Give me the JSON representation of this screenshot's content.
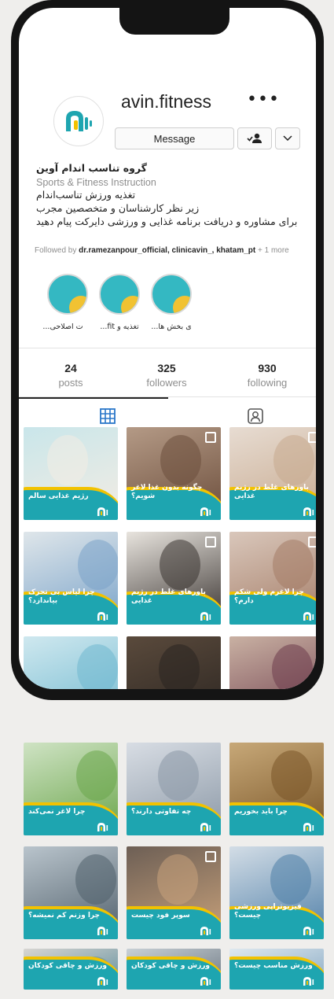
{
  "profile": {
    "username": "avin.fitness",
    "more_label": "•••",
    "message_label": "Message",
    "name": "گروه تناسب اندام آوین",
    "category": "Sports & Fitness Instruction",
    "bio_lines": [
      "تغذیه ورزش تناسب‌اندام",
      "زیر نظر کارشناسان و متخصصین مجرب",
      "برای مشاوره و دریافت برنامه غذایی و ورزشی دایرکت پیام دهید"
    ],
    "followed_prefix": "Followed by ",
    "followed_names": "dr.ramezanpour_official, clinicavin_, khatam_pt",
    "followed_more": " + 1 more"
  },
  "highlights": [
    {
      "label": "...ت اصلاحی"
    },
    {
      "label": "...fit تغذیه و"
    },
    {
      "label": "...ی بخش ها"
    }
  ],
  "stats": {
    "posts": {
      "value": "24",
      "label": "posts"
    },
    "followers": {
      "value": "325",
      "label": "followers"
    },
    "following": {
      "value": "930",
      "label": "following"
    }
  },
  "posts": [
    {
      "caption": "رژیم غذایی سالم",
      "colors": [
        "#c9e6ea",
        "#f3ece3"
      ]
    },
    {
      "caption": "چگونه بدون غذا لاغر شویم؟",
      "colors": [
        "#b49a86",
        "#6c4e3c"
      ]
    },
    {
      "caption": "باورهای غلط در رژیم غذایی",
      "colors": [
        "#e7dcd2",
        "#c7a98e"
      ]
    },
    {
      "caption": "چرا لیاس بی تحرک بیاندازد؟",
      "colors": [
        "#dfe6ea",
        "#7aa3c9"
      ]
    },
    {
      "caption": "باورهای غلط در رژیم غذایی",
      "colors": [
        "#e8e4de",
        "#3a3431"
      ]
    },
    {
      "caption": "چرا لاغرم ولی شکم دارم؟",
      "colors": [
        "#d9c7bb",
        "#a47c66"
      ]
    },
    {
      "caption": "",
      "colors": [
        "#cfe8ef",
        "#6fb8cf"
      ]
    },
    {
      "caption": "",
      "colors": [
        "#5a4a3c",
        "#2a2420"
      ]
    },
    {
      "caption": "",
      "colors": [
        "#c9b1a3",
        "#6e3d4c"
      ]
    },
    {
      "caption": "چرا لاغر نمی‌کند",
      "colors": [
        "#cfe3c4",
        "#6aa54a"
      ]
    },
    {
      "caption": "چه تفاوتی دارند؟",
      "colors": [
        "#d8dde4",
        "#8b98a6"
      ]
    },
    {
      "caption": "چرا باید بخوریم",
      "colors": [
        "#c7a878",
        "#7a5628"
      ]
    },
    {
      "caption": "چرا وزنم کم نمیشه؟",
      "colors": [
        "#b9c4cc",
        "#51606b"
      ]
    },
    {
      "caption": "سوپر فود چیست",
      "colors": [
        "#6d5f55",
        "#c9a27b"
      ]
    },
    {
      "caption": "فیزیوتراپی ورزشی چیست؟",
      "colors": [
        "#d3dde6",
        "#4f7fa8"
      ]
    },
    {
      "caption": "ورزش و چاقی کودکان",
      "colors": [
        "#d8d6d2",
        "#5b8b9a"
      ]
    },
    {
      "caption": "ورزش و چاقی کودکان",
      "colors": [
        "#c9d1d6",
        "#6a7580"
      ]
    },
    {
      "caption": "ورزش مناسب چیست؟",
      "colors": [
        "#dfe9ef",
        "#86a8c3"
      ]
    }
  ],
  "colors": {
    "brand_teal": "#1ea5b0",
    "brand_yellow": "#f2c200",
    "text_dark": "#262626",
    "text_muted": "#8e8e8e"
  }
}
